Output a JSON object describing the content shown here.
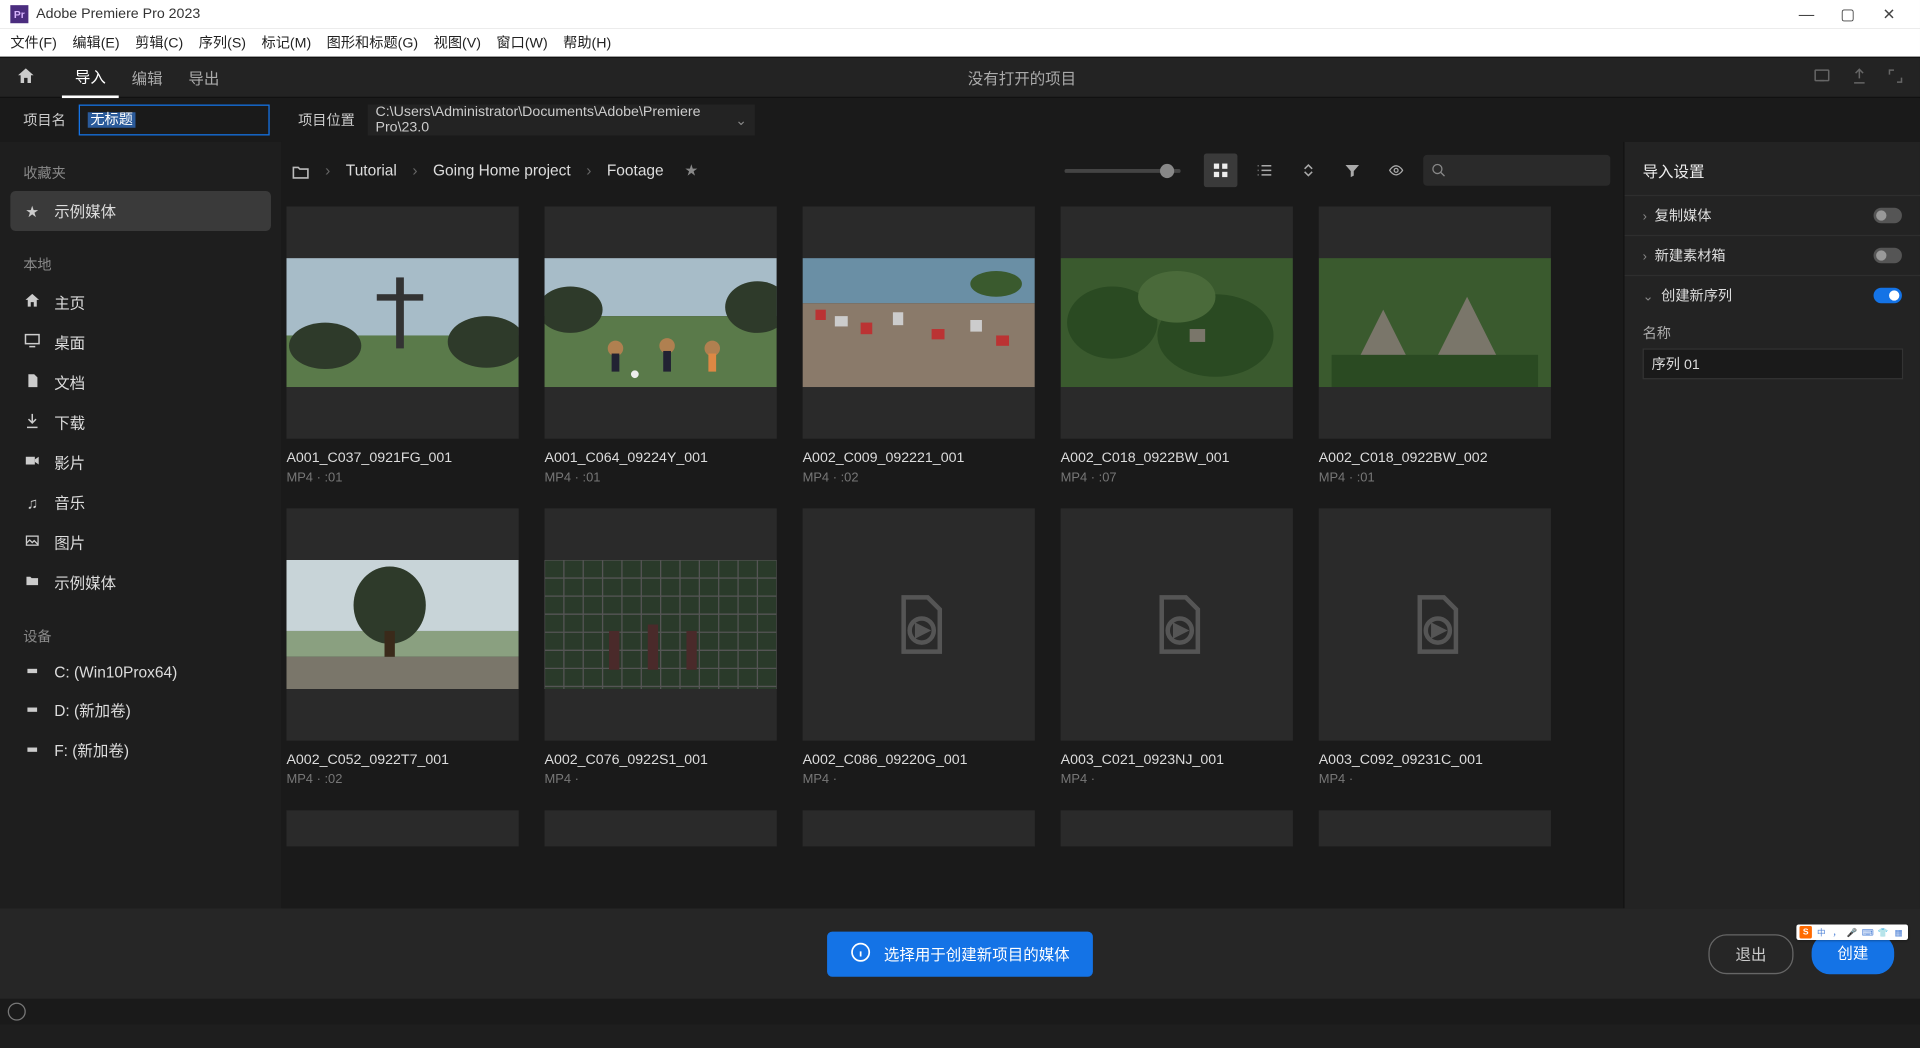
{
  "app": {
    "title": "Adobe Premiere Pro 2023"
  },
  "menu": {
    "file": "文件(F)",
    "edit": "编辑(E)",
    "clip": "剪辑(C)",
    "sequence": "序列(S)",
    "marker": "标记(M)",
    "graphics": "图形和标题(G)",
    "view": "视图(V)",
    "window": "窗口(W)",
    "help": "帮助(H)"
  },
  "top": {
    "tab_import": "导入",
    "tab_edit": "编辑",
    "tab_export": "导出",
    "center": "没有打开的项目"
  },
  "proj": {
    "name_label": "项目名",
    "name_value": "无标题",
    "loc_label": "项目位置",
    "loc_value": "C:\\Users\\Administrator\\Documents\\Adobe\\Premiere Pro\\23.0"
  },
  "sidebar": {
    "fav_label": "收藏夹",
    "sample_media": "示例媒体",
    "local_label": "本地",
    "home": "主页",
    "desktop": "桌面",
    "documents": "文档",
    "downloads": "下载",
    "movies": "影片",
    "music": "音乐",
    "pictures": "图片",
    "sample_media2": "示例媒体",
    "devices_label": "设备",
    "drive_c": "C: (Win10Prox64)",
    "drive_d": "D: (新加卷)",
    "drive_f": "F: (新加卷)"
  },
  "breadcrumb": {
    "a": "Tutorial",
    "b": "Going Home project",
    "c": "Footage"
  },
  "tiles": [
    {
      "name": "A001_C037_0921FG_001",
      "meta": "MP4 · :01",
      "img": "cross"
    },
    {
      "name": "A001_C064_09224Y_001",
      "meta": "MP4 · :01",
      "img": "soccer"
    },
    {
      "name": "A002_C009_092221_001",
      "meta": "MP4 · :02",
      "img": "town"
    },
    {
      "name": "A002_C018_0922BW_001",
      "meta": "MP4 · :07",
      "img": "jungle"
    },
    {
      "name": "A002_C018_0922BW_002",
      "meta": "MP4 · :01",
      "img": "ruins"
    },
    {
      "name": "A002_C052_0922T7_001",
      "meta": "MP4 · :02",
      "img": "cliff"
    },
    {
      "name": "A002_C076_0922S1_001",
      "meta": "MP4 ·",
      "img": "fence"
    },
    {
      "name": "A002_C086_09220G_001",
      "meta": "MP4 ·",
      "img": ""
    },
    {
      "name": "A003_C021_0923NJ_001",
      "meta": "MP4 ·",
      "img": ""
    },
    {
      "name": "A003_C092_09231C_001",
      "meta": "MP4 ·",
      "img": ""
    }
  ],
  "rpanel": {
    "title": "导入设置",
    "copy_media": "复制媒体",
    "new_bin": "新建素材箱",
    "create_sequence": "创建新序列",
    "name_label": "名称",
    "seq_name": "序列 01"
  },
  "footer": {
    "hint": "选择用于创建新项目的媒体",
    "exit": "退出",
    "create": "创建"
  },
  "ime": {
    "zh": "中"
  }
}
